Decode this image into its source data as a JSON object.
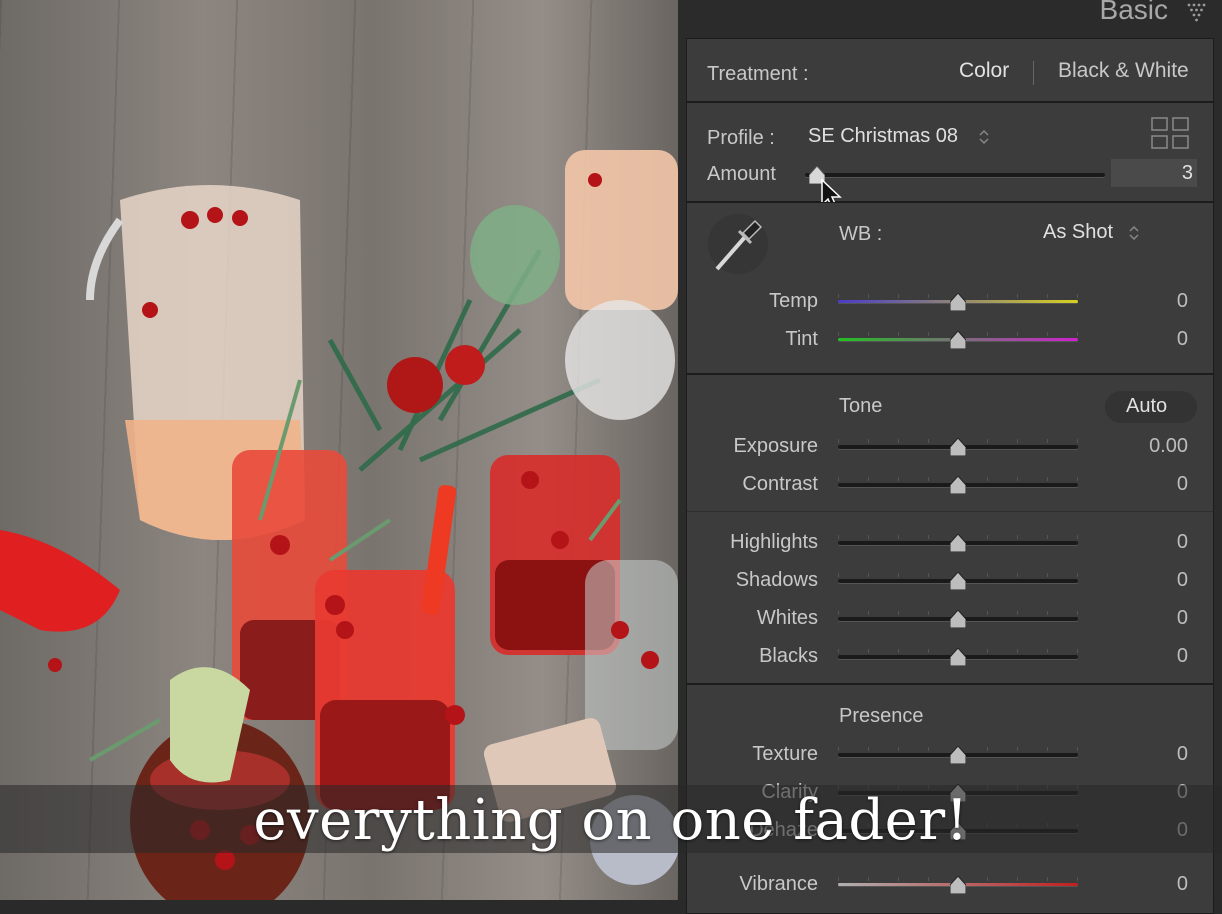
{
  "panel": {
    "title": "Basic"
  },
  "treatment": {
    "label": "Treatment :",
    "options": [
      "Color",
      "Black & White"
    ]
  },
  "profile": {
    "label": "Profile :",
    "value": "SE Christmas 08"
  },
  "amount": {
    "label": "Amount",
    "value": "3",
    "level": 0.03
  },
  "wb": {
    "label": "WB :",
    "value": "As Shot"
  },
  "sliders": {
    "temp": {
      "label": "Temp",
      "value": "0",
      "level": 0.5
    },
    "tint": {
      "label": "Tint",
      "value": "0",
      "level": 0.5
    },
    "exposure": {
      "label": "Exposure",
      "value": "0.00",
      "level": 0.5
    },
    "contrast": {
      "label": "Contrast",
      "value": "0",
      "level": 0.5
    },
    "highlights": {
      "label": "Highlights",
      "value": "0",
      "level": 0.5
    },
    "shadows": {
      "label": "Shadows",
      "value": "0",
      "level": 0.5
    },
    "whites": {
      "label": "Whites",
      "value": "0",
      "level": 0.5
    },
    "blacks": {
      "label": "Blacks",
      "value": "0",
      "level": 0.5
    },
    "texture": {
      "label": "Texture",
      "value": "0",
      "level": 0.5
    },
    "clarity": {
      "label": "Clarity",
      "value": "0",
      "level": 0.5
    },
    "dehaze": {
      "label": "Dehaze",
      "value": "0",
      "level": 0.5
    },
    "vibrance": {
      "label": "Vibrance",
      "value": "0",
      "level": 0.5
    }
  },
  "tone": {
    "label": "Tone",
    "auto_label": "Auto"
  },
  "presence": {
    "label": "Presence"
  },
  "caption": "everything on one fader!",
  "colors": {
    "panel_bg": "#3c3c3c",
    "temp_gradient": [
      "#4a3cc8",
      "#d8d020"
    ],
    "tint_gradient": [
      "#20c020",
      "#d020d0"
    ],
    "vibrance_gradient": [
      "#b0b0b0",
      "#c02020"
    ]
  }
}
